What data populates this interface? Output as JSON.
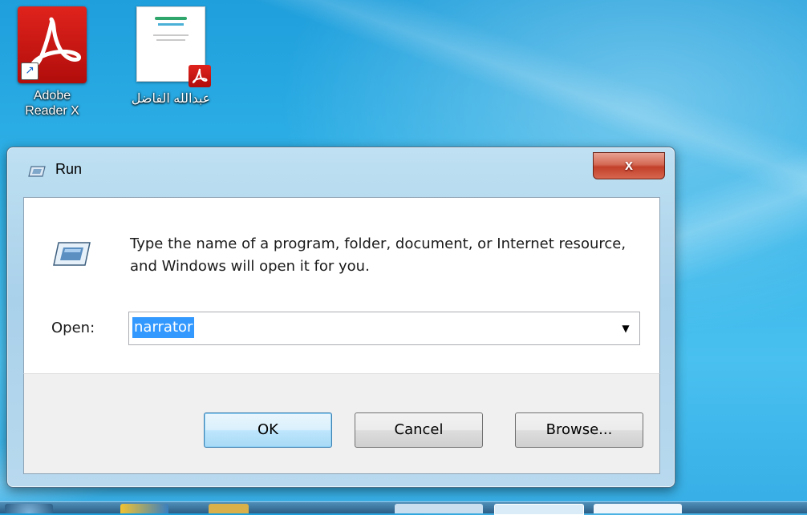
{
  "desktop": {
    "icons": [
      {
        "label_line1": "Adobe",
        "label_line2": "Reader X"
      },
      {
        "label": "عبدالله الفاضل"
      }
    ]
  },
  "run_dialog": {
    "title": "Run",
    "close_symbol": "x",
    "description": "Type the name of a program, folder, document, or Internet resource, and Windows will open it for you.",
    "open_label": "Open:",
    "open_value": "narrator",
    "buttons": {
      "ok": "OK",
      "cancel": "Cancel",
      "browse": "Browse..."
    }
  }
}
